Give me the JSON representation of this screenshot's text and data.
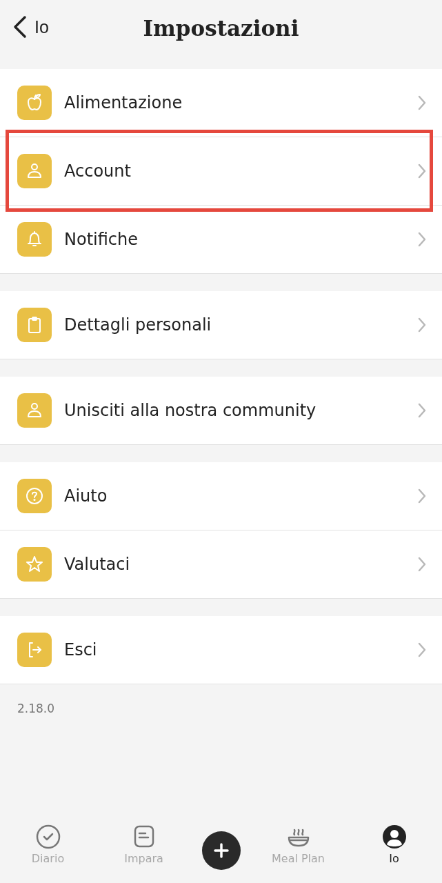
{
  "header": {
    "back_label": "Io",
    "title": "Impostazioni"
  },
  "groups": [
    {
      "items": [
        {
          "kind": "apple",
          "label": "Alimentazione",
          "highlighted": false
        },
        {
          "kind": "person",
          "label": "Account",
          "highlighted": true
        },
        {
          "kind": "bell",
          "label": "Notifiche",
          "highlighted": false
        }
      ]
    },
    {
      "items": [
        {
          "kind": "clipboard",
          "label": "Dettagli personali",
          "highlighted": false
        }
      ]
    },
    {
      "items": [
        {
          "kind": "person",
          "label": "Unisciti alla nostra community",
          "highlighted": false
        }
      ]
    },
    {
      "items": [
        {
          "kind": "question",
          "label": "Aiuto",
          "highlighted": false
        },
        {
          "kind": "star",
          "label": "Valutaci",
          "highlighted": false
        }
      ]
    },
    {
      "items": [
        {
          "kind": "exit",
          "label": "Esci",
          "highlighted": false
        }
      ]
    }
  ],
  "version": "2.18.0",
  "tab_bar": [
    {
      "kind": "check",
      "label": "Diario",
      "selected": false
    },
    {
      "kind": "note",
      "label": "Impara",
      "selected": false
    },
    {
      "kind": "add"
    },
    {
      "kind": "bowl",
      "label": "Meal Plan",
      "selected": false
    },
    {
      "kind": "profile",
      "label": "Io",
      "selected": true
    }
  ]
}
